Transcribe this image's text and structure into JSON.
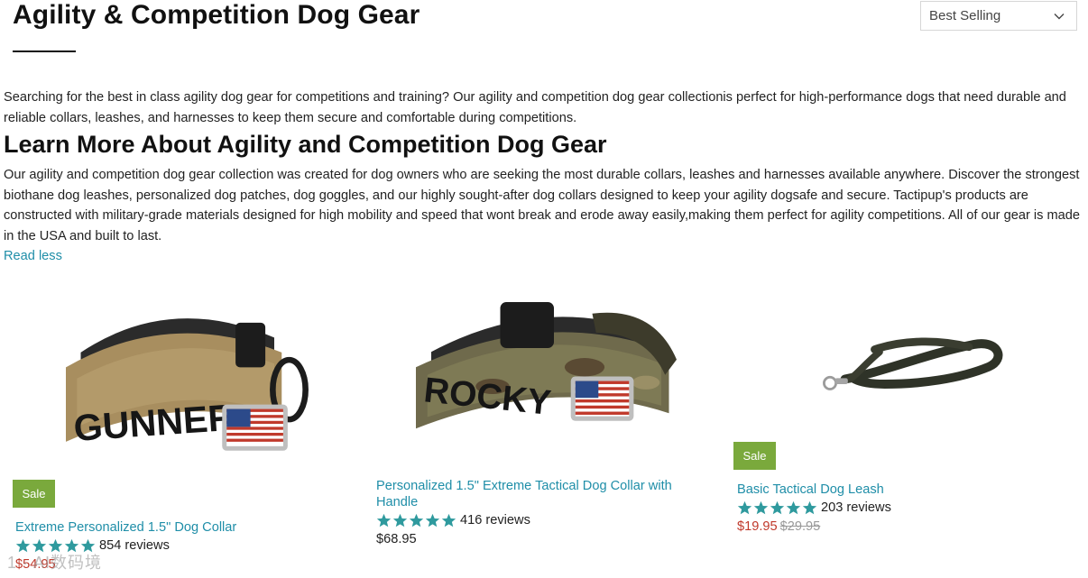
{
  "collection": {
    "title": "Agility & Competition Dog Gear",
    "intro": "Searching for the best in class agility dog gear for competitions and training? Our agility and competition dog gear collectionis perfect for high-performance dogs that need durable and reliable collars, leashes, and harnesses to keep them secure and comfortable during competitions.",
    "learn_heading": "Learn More About Agility and Competition Dog Gear",
    "learn_body": "Our agility and competition dog gear collection was created for dog owners who are seeking the most durable collars, leashes and harnesses available anywhere. Discover the strongest biothane dog leashes, personalized dog patches, dog goggles, and our highly sought-after dog collars designed to keep your agility dogsafe and secure. Tactipup's products are constructed with military-grade materials designed for high mobility and speed that wont break and erode away easily,making them perfect for agility competitions. All of our gear is made in the USA and built to last.",
    "read_less": "Read less"
  },
  "sort": {
    "selected": "Best Selling",
    "icon": "chevron-down-icon"
  },
  "colors": {
    "link": "#1f8ea8",
    "sale_badge": "#7aa93c",
    "sale_price": "#c0392b",
    "star": "#2f9a9e"
  },
  "products": [
    {
      "badge": "Sale",
      "name": "Extreme Personalized 1.5\" Dog Collar",
      "image_label": "GUNNER",
      "rating": 5,
      "reviews": "854 reviews",
      "price": "$54.95",
      "compare_price": ""
    },
    {
      "badge": "",
      "name": "Personalized 1.5\" Extreme Tactical Dog Collar with Handle",
      "image_label": "ROCKY",
      "rating": 5,
      "reviews": "416 reviews",
      "price": "$68.95",
      "compare_price": ""
    },
    {
      "badge": "Sale",
      "name": "Basic Tactical Dog Leash",
      "image_label": "",
      "rating": 5,
      "reviews": "203 reviews",
      "price": "$19.95",
      "compare_price": "$29.95"
    }
  ],
  "watermark": "1 · AI数码境"
}
